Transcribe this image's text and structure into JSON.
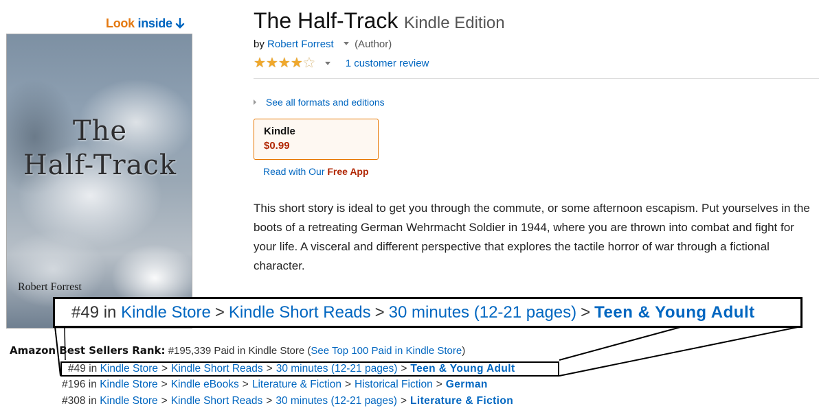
{
  "look_inside": {
    "look": "Look",
    "inside": "inside"
  },
  "cover": {
    "title_line1": "The",
    "title_line2": "Half-Track",
    "author": "Robert Forrest"
  },
  "product": {
    "title": "The Half-Track",
    "edition": "Kindle Edition",
    "by_prefix": "by",
    "author": "Robert Forrest",
    "author_role": "(Author)",
    "rating_stars": 4,
    "rating_max": 5,
    "review_link": "1 customer review"
  },
  "formats": {
    "see_all": "See all formats and editions",
    "selected_format": "Kindle",
    "selected_price": "$0.99",
    "read_with": "Read with Our",
    "free_app": "Free App"
  },
  "description": "This short story is ideal to get you through the commute, or some afternoon escapism. Put yourselves in the boots of a retreating German Wehrmacht Soldier in 1944, where you are thrown into combat and fight for your life. A visceral and different perspective that explores the tactile horror of war through a fictional character.",
  "zoom_callout": {
    "rank": "#49",
    "in": "in",
    "crumbs": [
      "Kindle Store",
      "Kindle Short Reads",
      "30 minutes (12-21 pages)"
    ],
    "final": "Teen & Young Adult",
    "sep": ">"
  },
  "best_sellers": {
    "label": "Amazon Best Sellers Rank:",
    "overall": "#195,339 Paid in Kindle Store (",
    "top100_link": "See Top 100 Paid in Kindle Store",
    "close_paren": ")",
    "ranks": [
      {
        "rank": "#49",
        "in": "in",
        "crumbs": [
          "Kindle Store",
          "Kindle Short Reads",
          "30 minutes (12-21 pages)"
        ],
        "final": "Teen & Young Adult"
      },
      {
        "rank": "#196",
        "in": "in",
        "crumbs": [
          "Kindle Store",
          "Kindle eBooks",
          "Literature & Fiction",
          "Historical Fiction"
        ],
        "final": "German"
      },
      {
        "rank": "#308",
        "in": "in",
        "crumbs": [
          "Kindle Store",
          "Kindle Short Reads",
          "30 minutes (12-21 pages)"
        ],
        "final": "Literature & Fiction"
      }
    ],
    "sep": ">"
  },
  "colors": {
    "link": "#0066c0",
    "price": "#b12704",
    "star": "#f0a82c",
    "look_orange": "#e47911",
    "format_border": "#e77600"
  }
}
